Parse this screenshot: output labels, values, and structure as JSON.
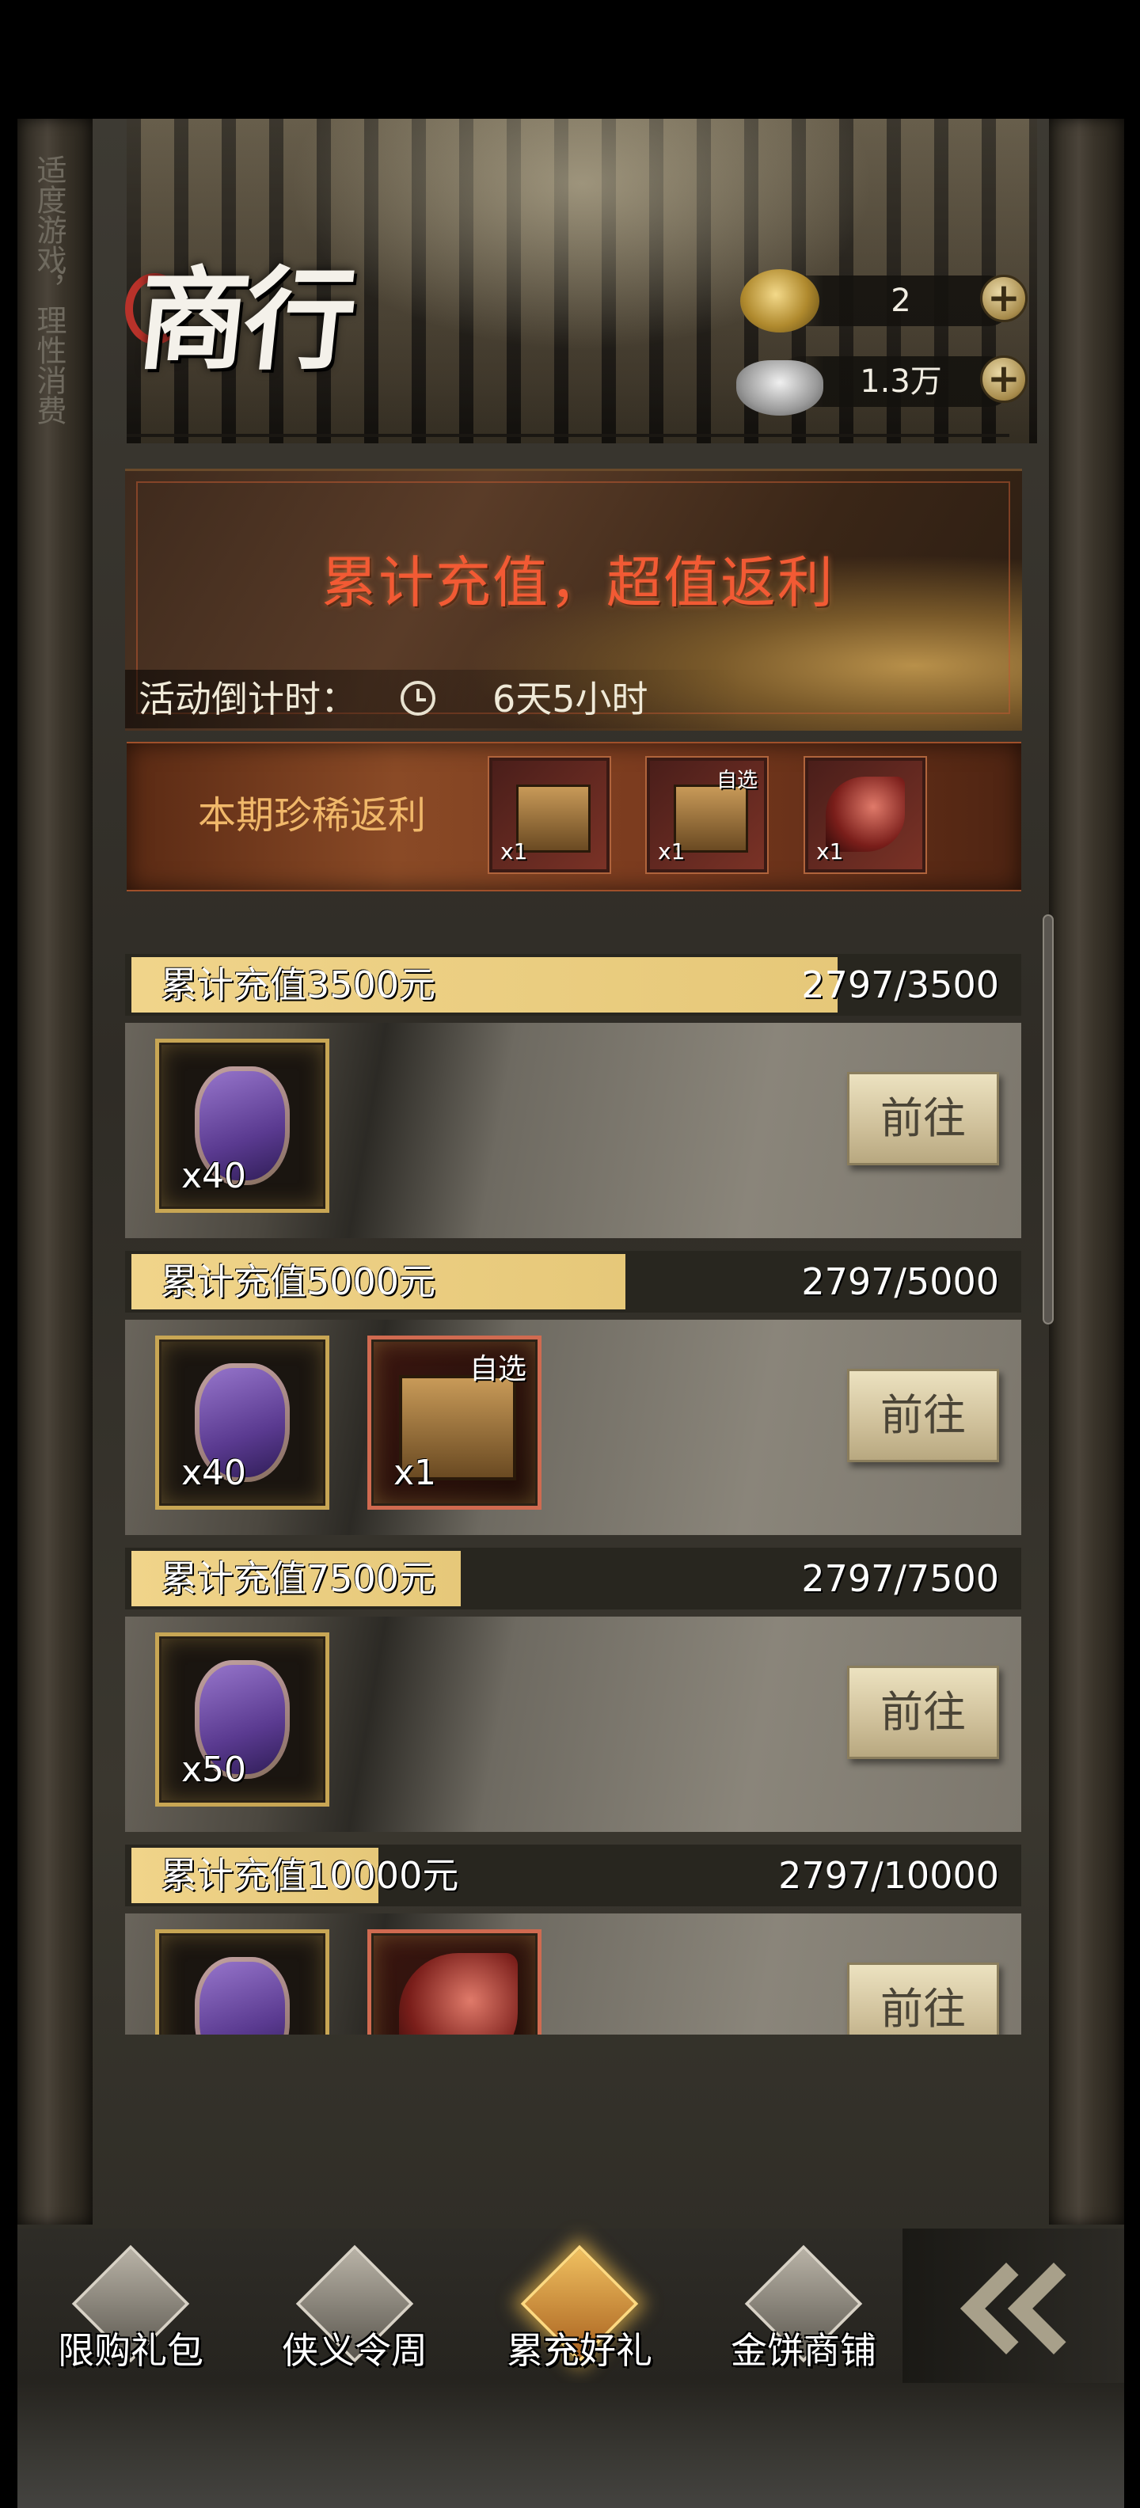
{
  "side_notice": "适度游戏，理性消费",
  "header": {
    "title": "商行",
    "currencies": [
      {
        "name": "gold",
        "value": "2"
      },
      {
        "name": "silver",
        "value": "1.3万"
      }
    ],
    "plus": "+"
  },
  "banner": {
    "title": "累计充值，超值返利",
    "countdown_label": "活动倒计时：",
    "countdown_value": "6天5小时"
  },
  "rare": {
    "label": "本期珍稀返利",
    "items": [
      {
        "qty": "x1",
        "tag": ""
      },
      {
        "qty": "x1",
        "tag": "自选"
      },
      {
        "qty": "x1",
        "tag": ""
      }
    ]
  },
  "tiers": [
    {
      "title": "累计充值3500元",
      "progress": "2797/3500",
      "fill": 0.7991,
      "button": "前往",
      "rewards": [
        {
          "type": "bag",
          "qty": "x40",
          "tag": ""
        }
      ]
    },
    {
      "title": "累计充值5000元",
      "progress": "2797/5000",
      "fill": 0.5594,
      "button": "前往",
      "rewards": [
        {
          "type": "bag",
          "qty": "x40",
          "tag": ""
        },
        {
          "type": "chest",
          "qty": "x1",
          "tag": "自选"
        }
      ]
    },
    {
      "title": "累计充值7500元",
      "progress": "2797/7500",
      "fill": 0.3729,
      "button": "前往",
      "rewards": [
        {
          "type": "bag",
          "qty": "x50",
          "tag": ""
        }
      ]
    },
    {
      "title": "累计充值10000元",
      "progress": "2797/10000",
      "fill": 0.2797,
      "button": "前往",
      "rewards": [
        {
          "type": "bag",
          "qty": "",
          "tag": ""
        },
        {
          "type": "phoenix",
          "qty": "",
          "tag": ""
        }
      ]
    }
  ],
  "nav": {
    "items": [
      {
        "label": "限购礼包",
        "active": false
      },
      {
        "label": "侠义令周",
        "active": false
      },
      {
        "label": "累充好礼",
        "active": true
      },
      {
        "label": "金饼商铺",
        "active": false
      }
    ]
  },
  "colors": {
    "accent_orange": "#f25a34",
    "progress_fill": "#e6c879",
    "rare_strip": "#8a4a26"
  }
}
